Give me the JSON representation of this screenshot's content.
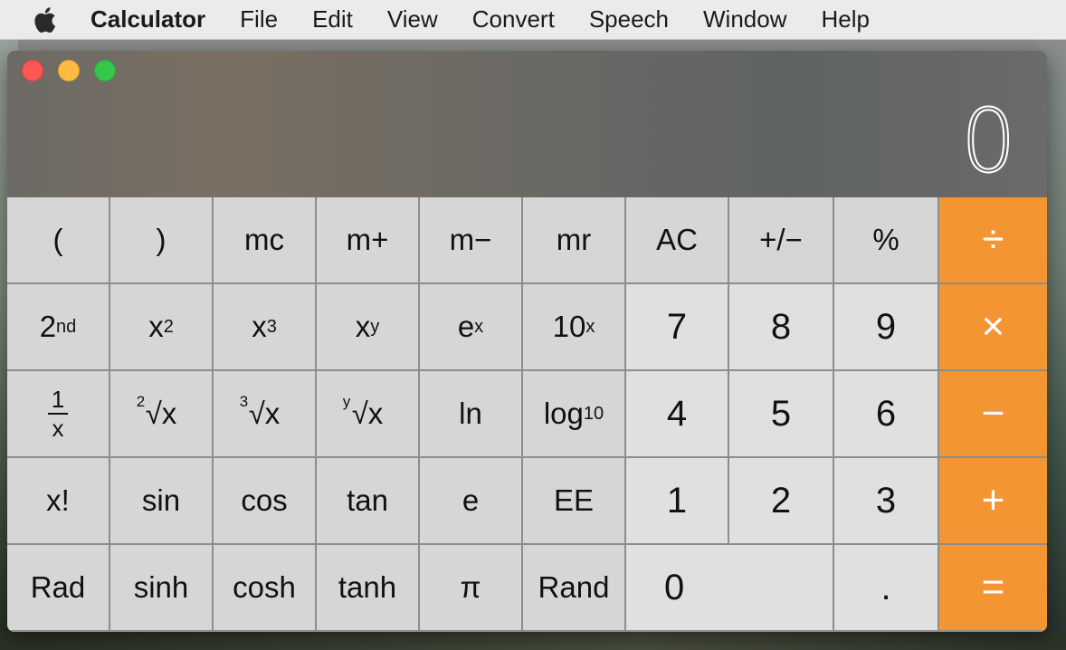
{
  "menubar": {
    "apple_icon": "apple-icon",
    "app_name": "Calculator",
    "items": [
      "File",
      "Edit",
      "View",
      "Convert",
      "Speech",
      "Window",
      "Help"
    ]
  },
  "window": {
    "display_value": "0",
    "traffic_lights": {
      "close": "#fc5753",
      "minimize": "#fdbc40",
      "zoom": "#34c84a"
    }
  },
  "keys": {
    "row1": {
      "lparen": "(",
      "rparen": ")",
      "mc": "mc",
      "mplus": "m+",
      "mminus": "m−",
      "mr": "mr",
      "ac": "AC",
      "plusminus": "+/−",
      "percent": "%",
      "divide": "÷"
    },
    "row2": {
      "second_base": "2",
      "second_sup": "nd",
      "x2_base": "x",
      "x2_sup": "2",
      "x3_base": "x",
      "x3_sup": "3",
      "xy_base": "x",
      "xy_sup": "y",
      "ex_base": "e",
      "ex_sup": "x",
      "tenx_base": "10",
      "tenx_sup": "x",
      "seven": "7",
      "eight": "8",
      "nine": "9",
      "multiply": "×"
    },
    "row3": {
      "recip_num": "1",
      "recip_den": "x",
      "sqrt_idx": "2",
      "sqrt_arg": "√x",
      "cbrt_idx": "3",
      "cbrt_arg": "√x",
      "yroot_idx": "y",
      "yroot_arg": "√x",
      "ln": "ln",
      "log_base": "log",
      "log_sub": "10",
      "four": "4",
      "five": "5",
      "six": "6",
      "minus": "−"
    },
    "row4": {
      "fact": "x!",
      "sin": "sin",
      "cos": "cos",
      "tan": "tan",
      "e": "e",
      "ee": "EE",
      "one": "1",
      "two": "2",
      "three": "3",
      "plus": "+"
    },
    "row5": {
      "rad": "Rad",
      "sinh": "sinh",
      "cosh": "cosh",
      "tanh": "tanh",
      "pi": "π",
      "rand": "Rand",
      "zero": "0",
      "dot": ".",
      "equals": "="
    }
  },
  "colors": {
    "operator": "#f39533",
    "menubar": "#ebebeb",
    "sci_key": "#d6d6d6",
    "num_key": "#e0e0e0"
  }
}
